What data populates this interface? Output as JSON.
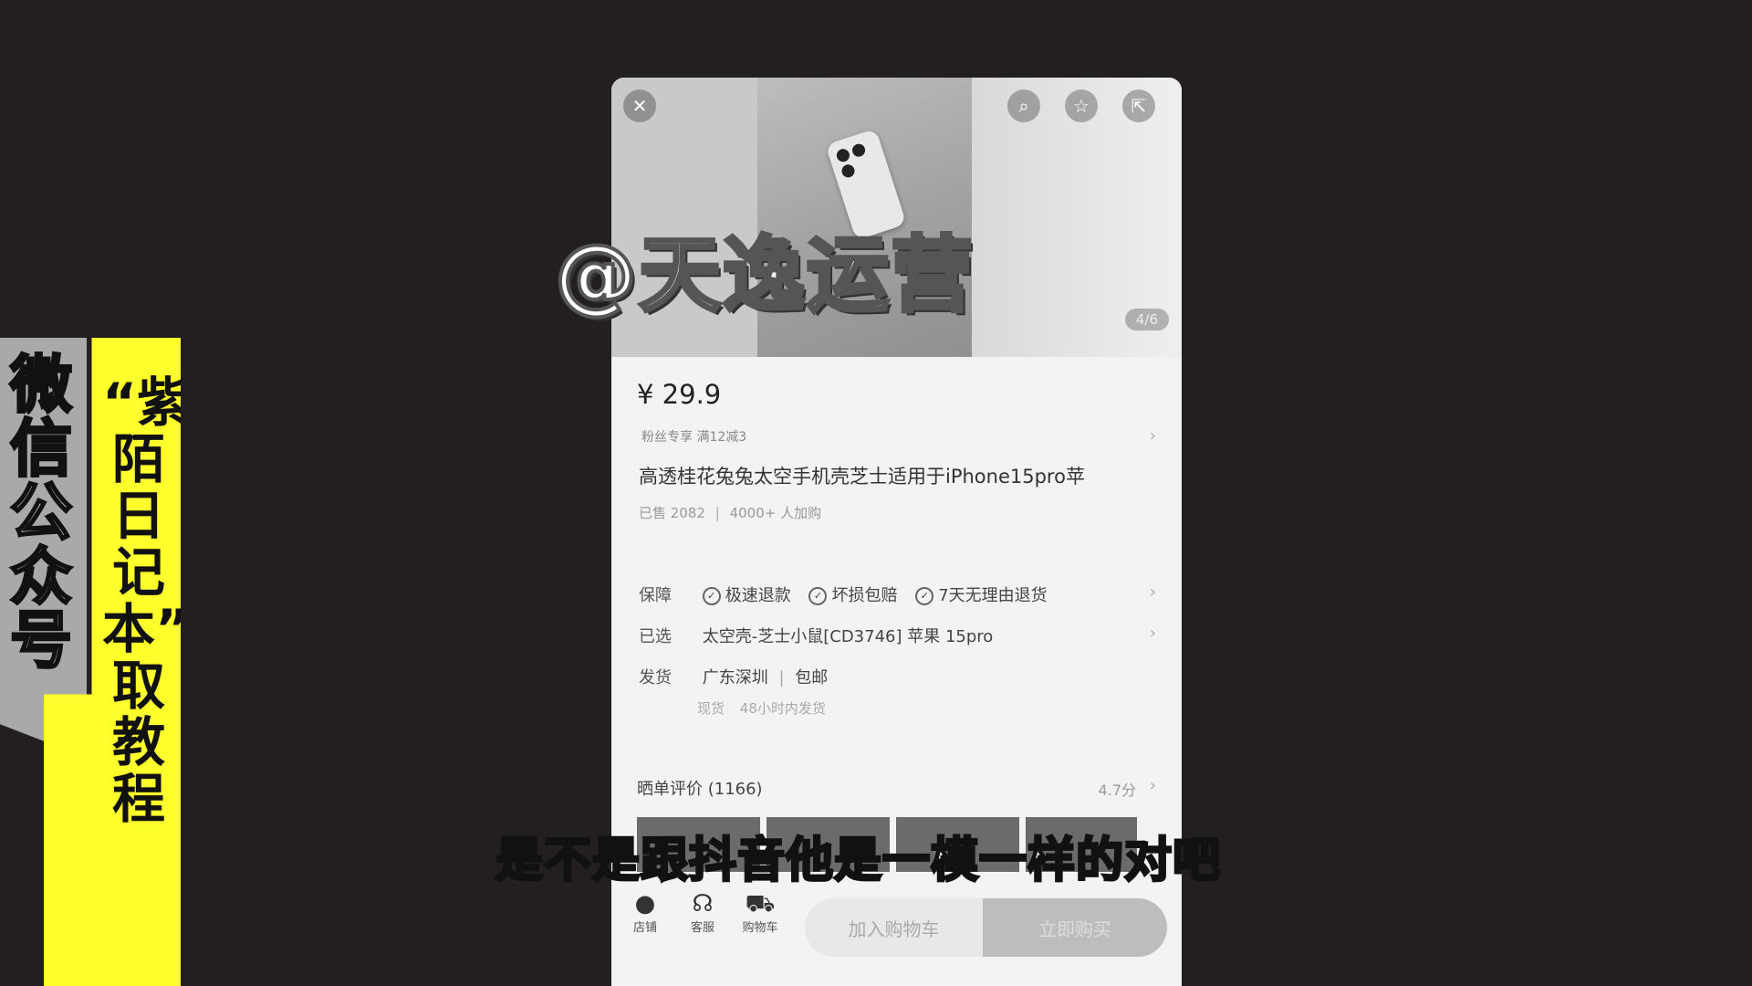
{
  "side_banner": {
    "gray_text": "微信公众号",
    "yellow_text": "“紫陌日记本”自取教程"
  },
  "watermark": "@天逸运营",
  "hero": {
    "counter": "4/6",
    "icons": [
      "close-icon",
      "search-icon",
      "star-icon",
      "share-icon"
    ]
  },
  "product": {
    "price": "¥ 29.9",
    "promo": "粉丝专享  满12减3",
    "title": "高透桂花兔兔太空手机壳芝士适用于iPhone15pro苹",
    "sold": "已售 2082",
    "buyers": "4000+ 人加购"
  },
  "guarantee": {
    "label": "保障",
    "items": [
      "极速退款",
      "坏损包赔",
      "7天无理由退货"
    ]
  },
  "selected": {
    "label": "已选",
    "value": "太空壳-芝士小鼠[CD3746] 苹果 15pro"
  },
  "shipping": {
    "label": "发货",
    "origin": "广东深圳",
    "fee": "包邮",
    "note_label": "现货",
    "note": "48小时内发货"
  },
  "reviews": {
    "title": "晒单评价 (1166)",
    "rating": "4.7分"
  },
  "bottom": {
    "store": "店铺",
    "service": "客服",
    "cart": "购物车",
    "add_cart": "加入购物车",
    "buy_now": "立即购买"
  },
  "subtitle": "是不是跟抖音他是一模一样的对吧"
}
